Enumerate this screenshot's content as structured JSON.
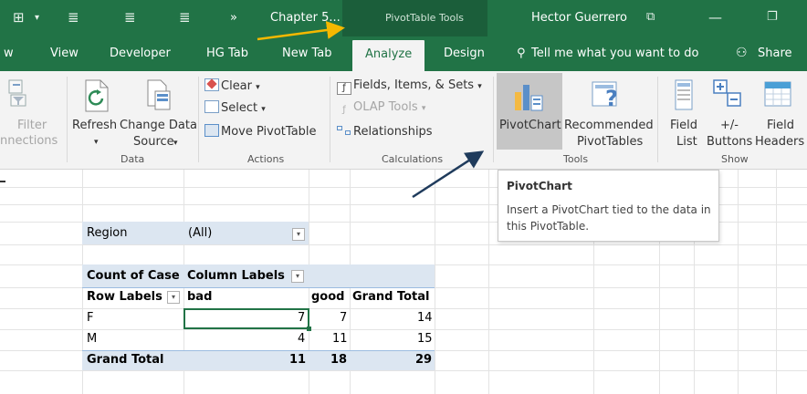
{
  "titlebar": {
    "doc_title": "Chapter 5...",
    "context_group": "PivotTable Tools",
    "user": "Hector Guerrero",
    "more": "»"
  },
  "tabs": [
    {
      "label": "w"
    },
    {
      "label": "View"
    },
    {
      "label": "Developer"
    },
    {
      "label": "HG Tab"
    },
    {
      "label": "New Tab"
    },
    {
      "label": "Analyze"
    },
    {
      "label": "Design"
    }
  ],
  "tell_me": "Tell me what you want to do",
  "share": "Share",
  "ribbon": {
    "filter": "Filter",
    "connections": "nnections",
    "refresh": "Refresh",
    "change_data": "Change Data",
    "source": "Source",
    "data_group": "Data",
    "clear": "Clear",
    "select": "Select",
    "move_pivottable": "Move PivotTable",
    "actions_group": "Actions",
    "fields_items_sets": "Fields, Items, & Sets",
    "olap_tools": "OLAP Tools",
    "relationships": "Relationships",
    "calculations_group": "Calculations",
    "pivotchart": "PivotChart",
    "recommended": "Recommended",
    "pivottables": "PivotTables",
    "tools_group": "Tools",
    "field": "Field",
    "list": "List",
    "plusminus": "+/-",
    "buttons": "Buttons",
    "field2": "Field",
    "headers": "Headers",
    "show_group": "Show"
  },
  "pivot": {
    "region_label": "Region",
    "region_value": "(All)",
    "count_of_case": "Count of Case",
    "column_labels": "Column Labels",
    "row_labels": "Row Labels",
    "col_headers": [
      "bad",
      "good",
      "Grand Total"
    ],
    "rows": [
      {
        "label": "F",
        "values": [
          "7",
          "7",
          "14"
        ]
      },
      {
        "label": "M",
        "values": [
          "4",
          "11",
          "15"
        ]
      }
    ],
    "grand_total": {
      "label": "Grand Total",
      "values": [
        "11",
        "18",
        "29"
      ]
    }
  },
  "tooltip": {
    "title": "PivotChart",
    "body": "Insert a PivotChart tied to the data in this PivotTable."
  },
  "colors": {
    "excel_green": "#217346",
    "pivot_fill": "#dce6f1",
    "arrow_gold": "#f5b800",
    "arrow_navy": "#1f3b5c"
  }
}
